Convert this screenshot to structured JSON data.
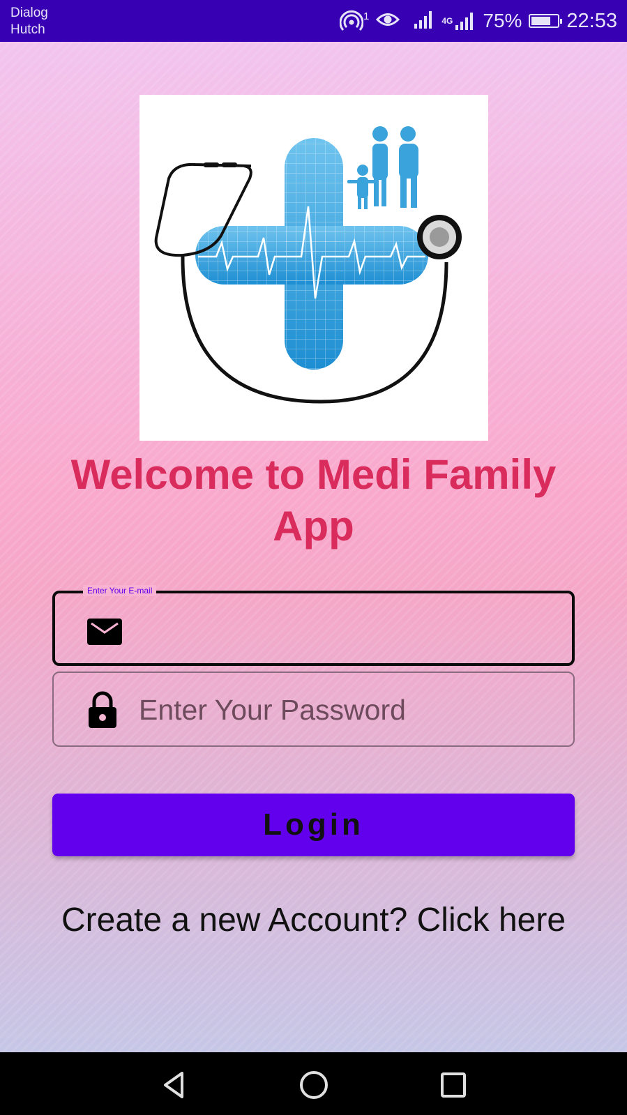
{
  "status_bar": {
    "carrier_line1": "Dialog",
    "carrier_line2": "Hutch",
    "hotspot_count": "1",
    "network_type": "4G",
    "battery_percent": "75%",
    "battery_level": 0.75,
    "time": "22:53"
  },
  "welcome": {
    "title": "Welcome to Medi Family App"
  },
  "email": {
    "label": "Enter Your E-mail",
    "value": "",
    "icon": "mail-icon"
  },
  "password": {
    "placeholder": "Enter Your Password",
    "value": "",
    "icon": "lock-icon"
  },
  "login": {
    "label": "Login"
  },
  "create_account": {
    "text": "Create a new Account? Click here"
  },
  "nav": {
    "back_icon": "back-triangle-icon",
    "home_icon": "home-circle-icon",
    "recents_icon": "recents-square-icon"
  },
  "colors": {
    "status_bar": "#3700b3",
    "title": "#d92c5c",
    "primary": "#6200ee",
    "field_label": "#6200ee"
  }
}
